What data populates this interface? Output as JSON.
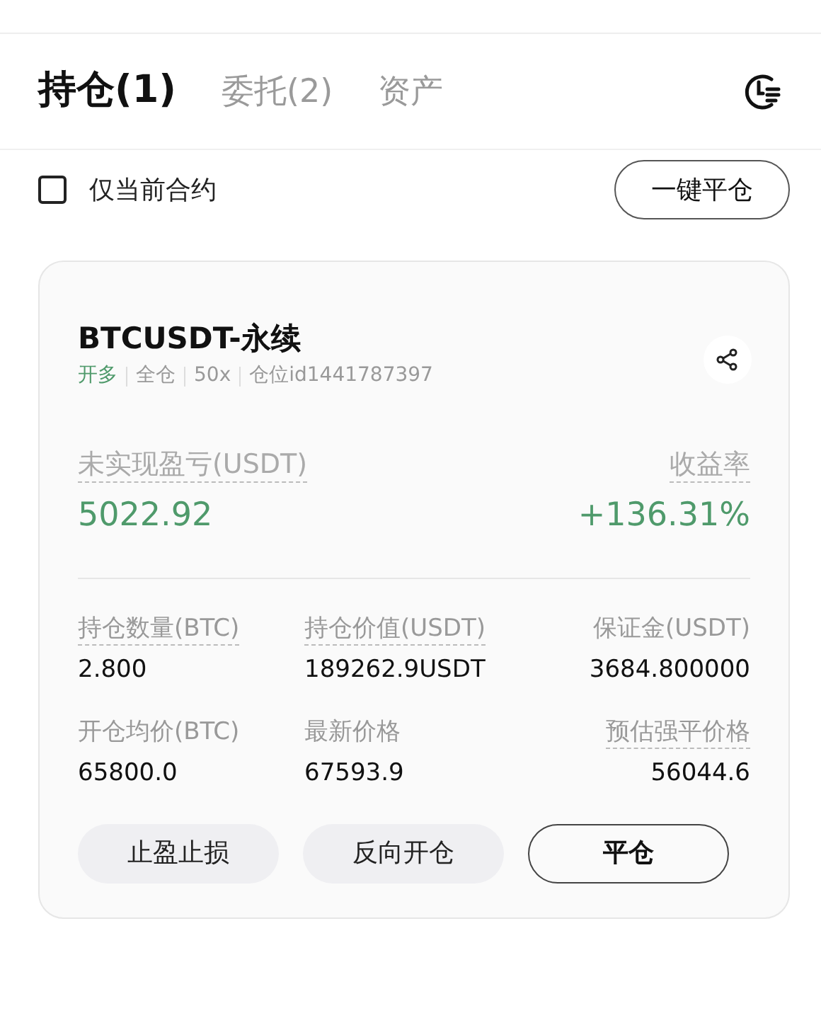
{
  "tabs": [
    {
      "label": "持仓(1)",
      "selected": true
    },
    {
      "label": "委托(2)",
      "selected": false
    },
    {
      "label": "资产",
      "selected": false
    }
  ],
  "filter": {
    "label": "仅当前合约",
    "checked": false
  },
  "close_all_button": "一键平仓",
  "position": {
    "symbol": "BTCUSDT-永续",
    "tags": [
      {
        "text": "开多",
        "kind": "side"
      },
      {
        "text": "全仓",
        "kind": "plain"
      },
      {
        "text": "50x",
        "kind": "plain"
      },
      {
        "text": "仓位id1441787397",
        "kind": "plain"
      }
    ],
    "pnl": {
      "label": "未实现盈亏(USDT)",
      "value": "5022.92"
    },
    "roi": {
      "label": "收益率",
      "value": "+136.31%"
    },
    "fields": [
      {
        "label": "持仓数量(BTC)",
        "value": "2.800",
        "dotted": true
      },
      {
        "label": "持仓价值(USDT)",
        "value": "189262.9USDT",
        "dotted": true
      },
      {
        "label": "保证金(USDT)",
        "value": "3684.800000",
        "dotted": false
      },
      {
        "label": "开仓均价(BTC)",
        "value": "65800.0",
        "dotted": false
      },
      {
        "label": "最新价格",
        "value": "67593.9",
        "dotted": false
      },
      {
        "label": "预估强平价格",
        "value": "56044.6",
        "dotted": true
      }
    ],
    "buttons": [
      {
        "label": "止盈止损",
        "kind": "filled"
      },
      {
        "label": "反向开仓",
        "kind": "filled"
      },
      {
        "label": "平仓",
        "kind": "outlined"
      }
    ]
  }
}
